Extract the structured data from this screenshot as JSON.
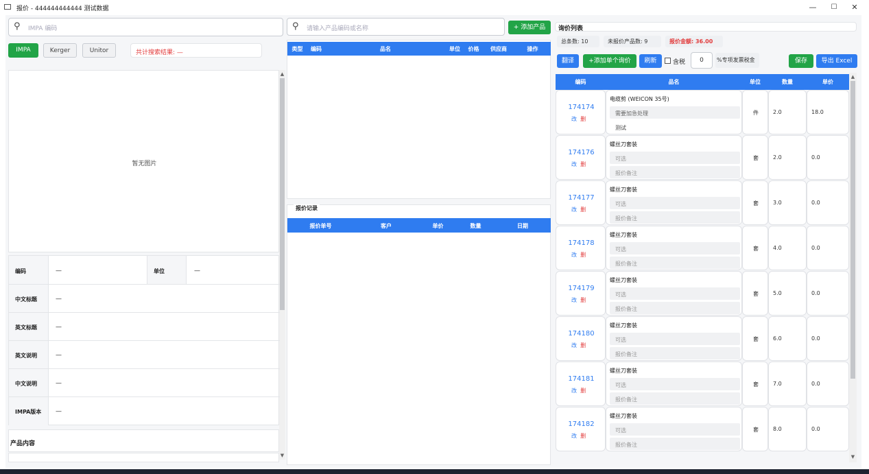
{
  "window": {
    "title": "报价 - 444444444444 测试数据",
    "min": "—",
    "max": "☐",
    "close": "✕"
  },
  "left": {
    "impa_placeholder": "IMPA 编码",
    "tabs": [
      "IMPA",
      "Kerger",
      "Unitor"
    ],
    "search_result": "共计搜索结果: —",
    "no_image": "暂无图片",
    "fields": [
      {
        "label": "编码",
        "value": "—"
      },
      {
        "label": "单位",
        "value": "—"
      },
      {
        "label": "中文标题",
        "value": "—"
      },
      {
        "label": "英文标题",
        "value": "—"
      },
      {
        "label": "英文说明",
        "value": "—"
      },
      {
        "label": "中文说明",
        "value": "—"
      },
      {
        "label": "IMPA版本",
        "value": "—"
      }
    ],
    "content_title": "产品内容"
  },
  "middle": {
    "search_placeholder": "请输入产品编码或名称",
    "add_product": "+ 添加产品",
    "columns": [
      "类型",
      "编码",
      "品名",
      "单位",
      "价格",
      "供应商",
      "操作"
    ],
    "history_title": "报价记录",
    "history_columns": [
      "报价单号",
      "客户",
      "单价",
      "数量",
      "日期"
    ]
  },
  "right": {
    "title": "询价列表",
    "total": "总条数: 10",
    "unquoted": "未报价产品数: 9",
    "amount": "报价金额: 36.00",
    "translate": "翻译",
    "add_single": "+添加单个询价",
    "refresh": "刷新",
    "tax_label": "含税",
    "tax_value": "0",
    "tax_suffix": "%专项发票税金",
    "save": "保存",
    "export": "导出 Excel",
    "columns": [
      "编码",
      "品名",
      "单位",
      "数量",
      "单价"
    ],
    "edit": "改",
    "del": "删",
    "rows": [
      {
        "code": "174174",
        "name": "电缆剪 (WEICON 35号)",
        "opt": "需要加急处理",
        "note": "测试",
        "unit": "件",
        "qty": "2.0",
        "price": "18.0"
      },
      {
        "code": "174176",
        "name": "螺丝刀套装",
        "opt": "可选",
        "note": "报价备注",
        "unit": "套",
        "qty": "2.0",
        "price": "0.0"
      },
      {
        "code": "174177",
        "name": "螺丝刀套装",
        "opt": "可选",
        "note": "报价备注",
        "unit": "套",
        "qty": "3.0",
        "price": "0.0"
      },
      {
        "code": "174178",
        "name": "螺丝刀套装",
        "opt": "可选",
        "note": "报价备注",
        "unit": "套",
        "qty": "4.0",
        "price": "0.0"
      },
      {
        "code": "174179",
        "name": "螺丝刀套装",
        "opt": "可选",
        "note": "报价备注",
        "unit": "套",
        "qty": "5.0",
        "price": "0.0"
      },
      {
        "code": "174180",
        "name": "螺丝刀套装",
        "opt": "可选",
        "note": "报价备注",
        "unit": "套",
        "qty": "6.0",
        "price": "0.0"
      },
      {
        "code": "174181",
        "name": "螺丝刀套装",
        "opt": "可选",
        "note": "报价备注",
        "unit": "套",
        "qty": "7.0",
        "price": "0.0"
      },
      {
        "code": "174182",
        "name": "螺丝刀套装",
        "opt": "可选",
        "note": "报价备注",
        "unit": "套",
        "qty": "8.0",
        "price": "0.0"
      }
    ]
  }
}
